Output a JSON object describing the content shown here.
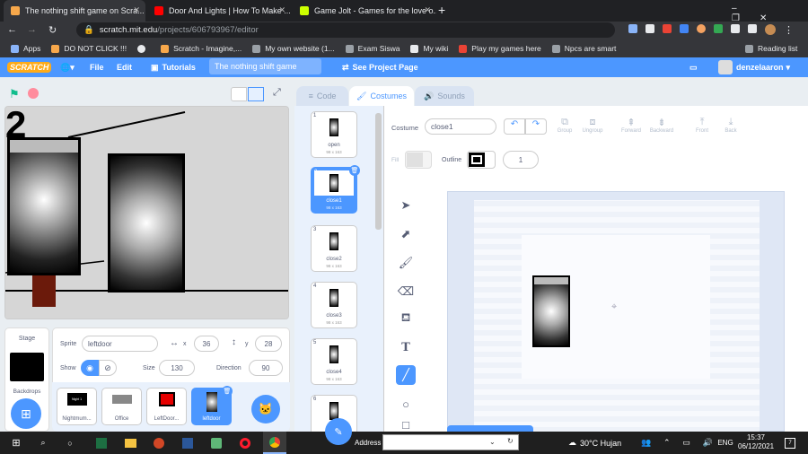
{
  "browser": {
    "tabs": [
      {
        "title": "The nothing shift game on Scra..."
      },
      {
        "title": "Door And Lights | How To Make ..."
      },
      {
        "title": "Game Jolt - Games for the love o..."
      }
    ],
    "new_tab": "+",
    "url_host": "scratch.mit.edu",
    "url_path": "/projects/606793967/editor",
    "bookmarks": [
      "Apps",
      "DO NOT CLICK !!!",
      "",
      "Scratch - Imagine,...",
      "My own website (1...",
      "Exam Siswa",
      "My wiki",
      "Play my games here",
      "Npcs are smart"
    ],
    "reading_list": "Reading list"
  },
  "menu": {
    "file": "File",
    "edit": "Edit",
    "tutorials": "Tutorials",
    "project_title": "The nothing shift game",
    "see_project": "See Project Page",
    "username": "denzelaaron"
  },
  "editor_tabs": {
    "code": "Code",
    "costumes": "Costumes",
    "sounds": "Sounds"
  },
  "costumes": [
    {
      "num": "1",
      "name": "open",
      "size": "98 x 163"
    },
    {
      "num": "2",
      "name": "close1",
      "size": "98 x 163"
    },
    {
      "num": "3",
      "name": "close2",
      "size": "98 x 163"
    },
    {
      "num": "4",
      "name": "close3",
      "size": "98 x 163"
    },
    {
      "num": "5",
      "name": "close4",
      "size": "98 x 163"
    },
    {
      "num": "6",
      "name": "",
      "size": ""
    }
  ],
  "paint": {
    "costume_label": "Costume",
    "costume_name": "close1",
    "group": "Group",
    "ungroup": "Ungroup",
    "forward": "Forward",
    "backward": "Backward",
    "front": "Front",
    "back": "Back",
    "fill": "Fill",
    "outline": "Outline",
    "outline_width": "1"
  },
  "sprite_info": {
    "sprite_label": "Sprite",
    "sprite_name": "leftdoor",
    "x_label": "x",
    "x": "36",
    "y_label": "y",
    "y": "28",
    "show_label": "Show",
    "size_label": "Size",
    "size": "130",
    "direction_label": "Direction",
    "direction": "90"
  },
  "stage_panel": {
    "title": "Stage",
    "backdrops": "Backdrops"
  },
  "sprites": [
    {
      "name": "Nightmum..."
    },
    {
      "name": "Office"
    },
    {
      "name": "LeftDoor..."
    },
    {
      "name": "leftdoor"
    }
  ],
  "stage_number": "2",
  "sprite_thumb_text": "Night 1",
  "taskbar": {
    "address_label": "Address",
    "weather": "30°C Hujan",
    "lang": "ENG",
    "time": "15:37",
    "date": "06/12/2021",
    "notif": "7"
  }
}
